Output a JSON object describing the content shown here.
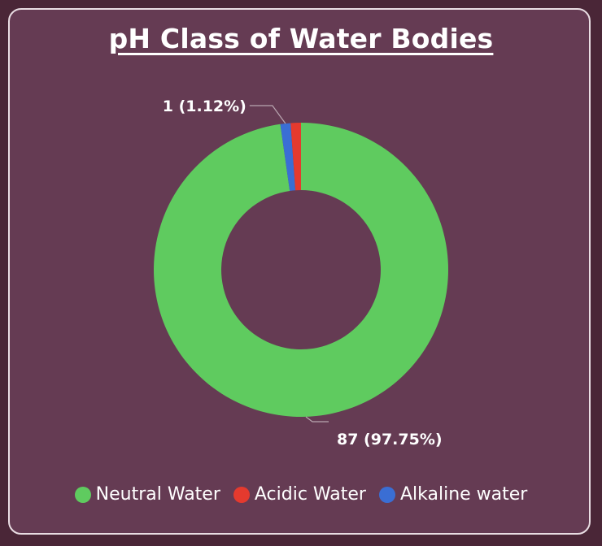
{
  "chart_data": {
    "type": "pie",
    "title": "pH Class of Water Bodies",
    "donut": true,
    "legend_position": "bottom",
    "series": [
      {
        "name": "Neutral Water",
        "value": 87,
        "percent": 97.75,
        "color": "#5fcb5f"
      },
      {
        "name": "Acidic Water",
        "value": 1,
        "percent": 1.12,
        "color": "#e53a2e"
      },
      {
        "name": "Alkaline water",
        "value": 1,
        "percent": 1.12,
        "color": "#3a6ed4"
      }
    ],
    "data_labels": [
      {
        "text": "1 (1.12%)",
        "series": "Alkaline water"
      },
      {
        "text": "87 (97.75%)",
        "series": "Neutral Water"
      }
    ]
  }
}
